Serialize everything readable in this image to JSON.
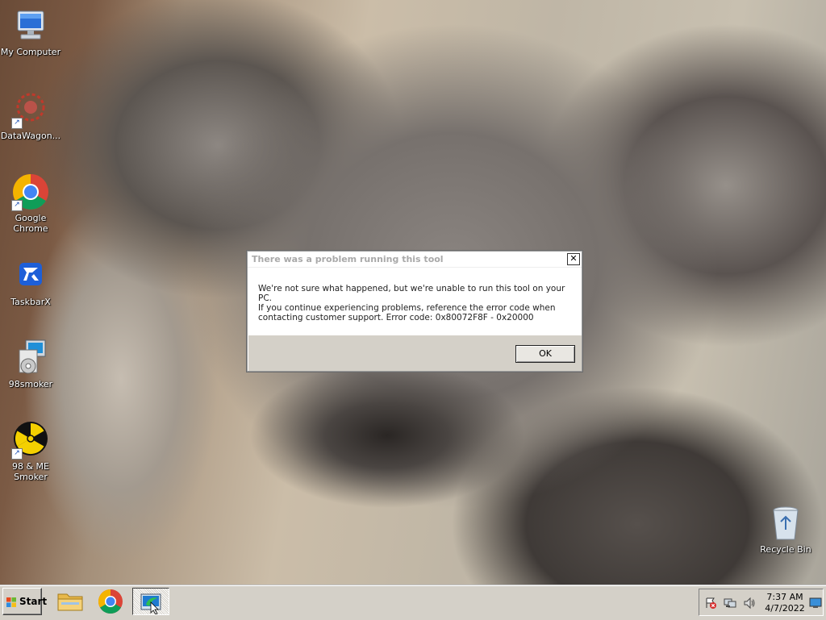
{
  "desktop_icons": [
    {
      "label": "My Computer",
      "icon": "my-computer-icon"
    },
    {
      "label": "DataWagon...",
      "icon": "datawagon-icon"
    },
    {
      "label": "Google Chrome",
      "icon": "chrome-icon"
    },
    {
      "label": "TaskbarX",
      "icon": "taskbarx-icon"
    },
    {
      "label": "98smoker",
      "icon": "installer-icon"
    },
    {
      "label": "98 & ME Smoker",
      "icon": "radiation-icon"
    },
    {
      "label": "Recycle Bin",
      "icon": "recycle-bin-icon"
    }
  ],
  "dialog": {
    "title": "There was a problem running this tool",
    "message": "We're not sure what happened, but we're unable to run this tool on your PC.\nIf you continue experiencing problems, reference the error code when\ncontacting customer support. Error code: 0x80072F8F - 0x20000",
    "ok_label": "OK",
    "close_glyph": "✕"
  },
  "taskbar": {
    "start_label": "Start",
    "pinned": [
      {
        "name": "file-explorer",
        "icon": "folder-icon"
      },
      {
        "name": "google-chrome",
        "icon": "chrome-icon"
      },
      {
        "name": "media-creation-tool",
        "icon": "media-creation-tool-icon",
        "active": true
      }
    ],
    "clock_time": "7:37 AM",
    "clock_date": "4/7/2022"
  },
  "colors": {
    "dialog_title_text": "#a9a9a9",
    "taskbar": "#d4d0c8",
    "chrome_red": "#db4437",
    "chrome_green": "#0f9d58",
    "chrome_yellow": "#f4b400",
    "chrome_blue": "#4285f4"
  }
}
